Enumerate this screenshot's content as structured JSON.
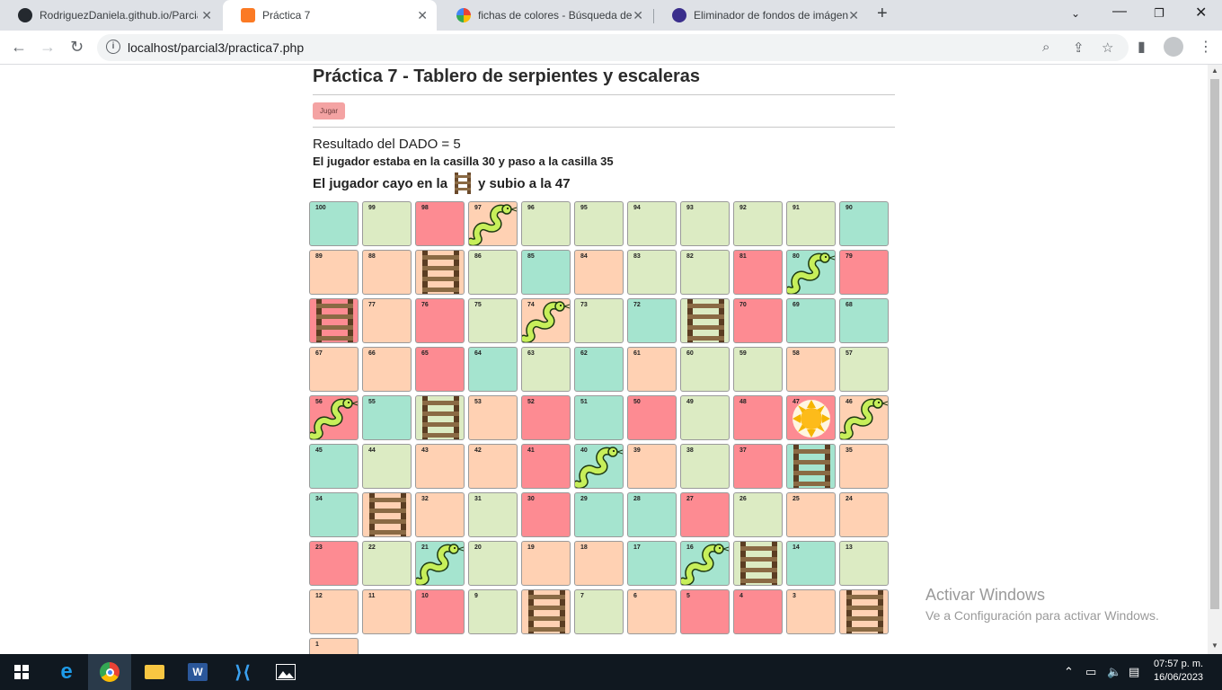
{
  "browser": {
    "tabs": [
      {
        "title": "RodriguezDaniela.github.io/Parcia",
        "icon": "github-icon",
        "active": false
      },
      {
        "title": "Práctica 7",
        "icon": "xampp-icon",
        "active": true
      },
      {
        "title": "fichas de colores - Búsqueda de G",
        "icon": "google-icon",
        "active": false
      },
      {
        "title": "Eliminador de fondos de imágene",
        "icon": "remove-bg-icon",
        "active": false
      }
    ],
    "url": "localhost/parcial3/practica7.php"
  },
  "page": {
    "title": "Práctica 7 - Tablero de serpientes y escaleras",
    "play_label": "Jugar",
    "dice_result": "Resultado del DADO = 5",
    "moved_text": "El jugador estaba en la casilla 30 y paso a la casilla 35",
    "landed_before": "El jugador cayo en la",
    "landed_after": "y subio a la 47"
  },
  "board": {
    "rows": [
      [
        {
          "n": "100",
          "c": "teal"
        },
        {
          "n": "99",
          "c": "green"
        },
        {
          "n": "98",
          "c": "pink"
        },
        {
          "n": "97",
          "c": "peach",
          "i": "snake"
        },
        {
          "n": "96",
          "c": "green"
        },
        {
          "n": "95",
          "c": "green"
        },
        {
          "n": "94",
          "c": "green"
        },
        {
          "n": "93",
          "c": "green"
        },
        {
          "n": "92",
          "c": "green"
        },
        {
          "n": "91",
          "c": "green"
        },
        {
          "n": "90",
          "c": "teal"
        }
      ],
      [
        {
          "n": "89",
          "c": "peach"
        },
        {
          "n": "88",
          "c": "peach"
        },
        {
          "n": "",
          "c": "peach",
          "i": "ladder"
        },
        {
          "n": "86",
          "c": "green"
        },
        {
          "n": "85",
          "c": "teal"
        },
        {
          "n": "84",
          "c": "peach"
        },
        {
          "n": "83",
          "c": "green"
        },
        {
          "n": "82",
          "c": "green"
        },
        {
          "n": "81",
          "c": "pink"
        },
        {
          "n": "80",
          "c": "teal",
          "i": "snake"
        },
        {
          "n": "79",
          "c": "pink"
        }
      ],
      [
        {
          "n": "",
          "c": "pink",
          "i": "ladder"
        },
        {
          "n": "77",
          "c": "peach"
        },
        {
          "n": "76",
          "c": "pink"
        },
        {
          "n": "75",
          "c": "green"
        },
        {
          "n": "74",
          "c": "peach",
          "i": "snake"
        },
        {
          "n": "73",
          "c": "green"
        },
        {
          "n": "72",
          "c": "teal"
        },
        {
          "n": "",
          "c": "green",
          "i": "ladder"
        },
        {
          "n": "70",
          "c": "pink"
        },
        {
          "n": "69",
          "c": "teal"
        },
        {
          "n": "68",
          "c": "teal"
        }
      ],
      [
        {
          "n": "67",
          "c": "peach"
        },
        {
          "n": "66",
          "c": "peach"
        },
        {
          "n": "65",
          "c": "pink"
        },
        {
          "n": "64",
          "c": "teal"
        },
        {
          "n": "63",
          "c": "green"
        },
        {
          "n": "62",
          "c": "teal"
        },
        {
          "n": "61",
          "c": "peach"
        },
        {
          "n": "60",
          "c": "green"
        },
        {
          "n": "59",
          "c": "green"
        },
        {
          "n": "58",
          "c": "peach"
        },
        {
          "n": "57",
          "c": "green"
        }
      ],
      [
        {
          "n": "56",
          "c": "pink",
          "i": "snake"
        },
        {
          "n": "55",
          "c": "teal"
        },
        {
          "n": "",
          "c": "green",
          "i": "ladder"
        },
        {
          "n": "53",
          "c": "peach"
        },
        {
          "n": "52",
          "c": "pink"
        },
        {
          "n": "51",
          "c": "teal"
        },
        {
          "n": "50",
          "c": "pink"
        },
        {
          "n": "49",
          "c": "green"
        },
        {
          "n": "48",
          "c": "pink"
        },
        {
          "n": "47",
          "c": "pink",
          "i": "token"
        },
        {
          "n": "46",
          "c": "peach",
          "i": "snake"
        }
      ],
      [
        {
          "n": "45",
          "c": "teal"
        },
        {
          "n": "44",
          "c": "green"
        },
        {
          "n": "43",
          "c": "peach"
        },
        {
          "n": "42",
          "c": "peach"
        },
        {
          "n": "41",
          "c": "pink"
        },
        {
          "n": "40",
          "c": "teal",
          "i": "snake"
        },
        {
          "n": "39",
          "c": "peach"
        },
        {
          "n": "38",
          "c": "green"
        },
        {
          "n": "37",
          "c": "pink"
        },
        {
          "n": "",
          "c": "teal",
          "i": "ladder"
        },
        {
          "n": "35",
          "c": "peach"
        }
      ],
      [
        {
          "n": "34",
          "c": "teal"
        },
        {
          "n": "",
          "c": "peach",
          "i": "ladder"
        },
        {
          "n": "32",
          "c": "peach"
        },
        {
          "n": "31",
          "c": "green"
        },
        {
          "n": "30",
          "c": "pink"
        },
        {
          "n": "29",
          "c": "teal"
        },
        {
          "n": "28",
          "c": "teal"
        },
        {
          "n": "27",
          "c": "pink"
        },
        {
          "n": "26",
          "c": "green"
        },
        {
          "n": "25",
          "c": "peach"
        },
        {
          "n": "24",
          "c": "peach"
        }
      ],
      [
        {
          "n": "23",
          "c": "pink"
        },
        {
          "n": "22",
          "c": "green"
        },
        {
          "n": "21",
          "c": "teal",
          "i": "snake"
        },
        {
          "n": "20",
          "c": "green"
        },
        {
          "n": "19",
          "c": "peach"
        },
        {
          "n": "18",
          "c": "peach"
        },
        {
          "n": "17",
          "c": "teal"
        },
        {
          "n": "16",
          "c": "teal",
          "i": "snake"
        },
        {
          "n": "",
          "c": "green",
          "i": "ladder"
        },
        {
          "n": "14",
          "c": "teal"
        },
        {
          "n": "13",
          "c": "green"
        }
      ],
      [
        {
          "n": "12",
          "c": "peach"
        },
        {
          "n": "11",
          "c": "peach"
        },
        {
          "n": "10",
          "c": "pink"
        },
        {
          "n": "9",
          "c": "green"
        },
        {
          "n": "",
          "c": "peach",
          "i": "ladder"
        },
        {
          "n": "7",
          "c": "green"
        },
        {
          "n": "6",
          "c": "peach"
        },
        {
          "n": "5",
          "c": "pink"
        },
        {
          "n": "4",
          "c": "pink"
        },
        {
          "n": "3",
          "c": "peach"
        },
        {
          "n": "",
          "c": "peach",
          "i": "ladder"
        }
      ],
      [
        {
          "n": "1",
          "c": "peach"
        }
      ]
    ]
  },
  "watermark": {
    "line1": "Activar Windows",
    "line2": "Ve a Configuración para activar Windows."
  },
  "taskbar": {
    "time": "07:57 p. m.",
    "date": "16/06/2023"
  },
  "colors": {
    "pink": "#fd8b92",
    "peach": "#ffd1b3",
    "green": "#dcebc3",
    "teal": "#a5e4cf"
  }
}
